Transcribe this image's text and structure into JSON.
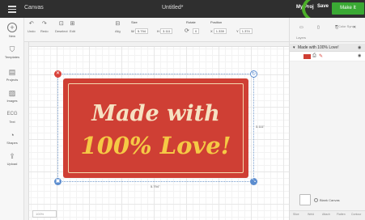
{
  "header": {
    "app_name": "Canvas",
    "doc_title": "Untitled*",
    "project_link": "My Proj",
    "save_label": "Save",
    "make_label": "Make It",
    "accent_color": "#3aa934"
  },
  "toolbar": {
    "undo_label": "Undo",
    "redo_label": "Redo",
    "deselect_label": "Deselect",
    "edit_label": "Edit",
    "align_label": "Alig",
    "size_label": "Size",
    "size_w_label": "W",
    "size_w_value": "5.794",
    "size_h_label": "H",
    "size_h_value": "3.111",
    "rotate_label": "Rotate",
    "rotate_value": "0",
    "position_label": "Position",
    "pos_x_label": "X",
    "pos_x_value": "1.339",
    "pos_y_label": "Y",
    "pos_y_value": "1.374"
  },
  "sidebar": {
    "items": [
      {
        "label": "New",
        "icon": "plus-icon"
      },
      {
        "label": "Templates",
        "icon": "shirt-icon"
      },
      {
        "label": "Projects",
        "icon": "grid-icon"
      },
      {
        "label": "Images",
        "icon": "image-icon"
      },
      {
        "label": "Text",
        "icon": "text-icon"
      },
      {
        "label": "Shapes",
        "icon": "shapes-icon"
      },
      {
        "label": "Upload",
        "icon": "upload-icon"
      }
    ]
  },
  "canvas": {
    "line1": "Made with",
    "line2": "100% Love!",
    "width_dim": "5.794\"",
    "height_dim": "3.111\"",
    "sign_color": "#cf3f34"
  },
  "rpanel": {
    "tab_layers": "Layers",
    "tab_color_sync": "Color Sync",
    "group_title": "Made with 100% Love!",
    "blank_canvas": "Blank Canvas",
    "footer": [
      "Slice",
      "Weld",
      "Attach",
      "Flatten",
      "Contour"
    ]
  }
}
